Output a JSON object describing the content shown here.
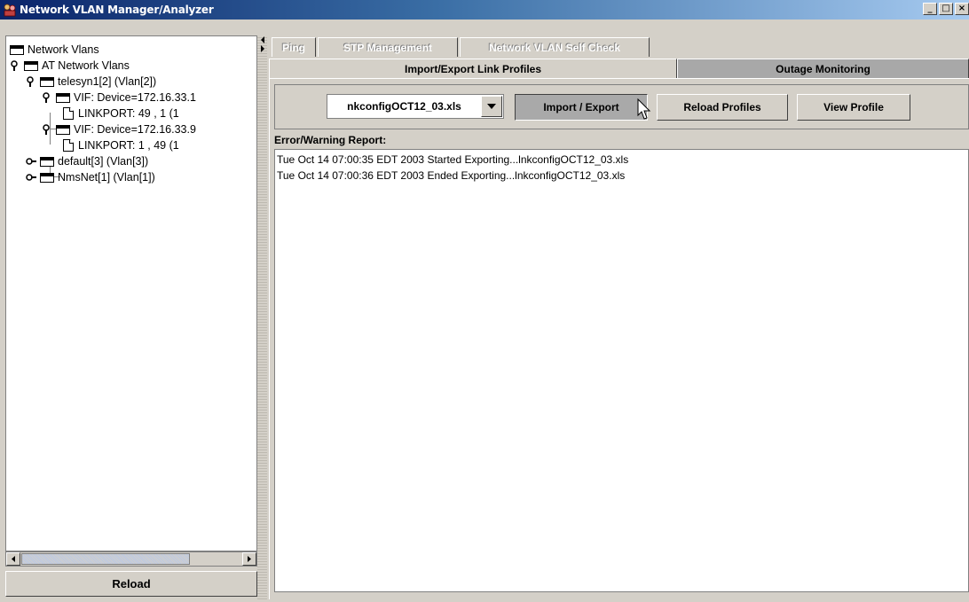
{
  "window": {
    "title": "Network VLAN Manager/Analyzer",
    "controls": {
      "minimize": "_",
      "maximize": "□",
      "close": "×"
    }
  },
  "tree": {
    "items": [
      {
        "label": "Network Vlans",
        "icon": "folder-icon"
      },
      {
        "label": "AT Network Vlans",
        "icon": "folder-icon"
      },
      {
        "label": "telesyn1[2] (Vlan[2])",
        "icon": "folder-icon"
      },
      {
        "label": "VIF: Device=172.16.33.1",
        "icon": "folder-icon"
      },
      {
        "label": "LINKPORT: 49  , 1 (1",
        "icon": "file-icon"
      },
      {
        "label": "VIF: Device=172.16.33.9",
        "icon": "folder-icon"
      },
      {
        "label": "LINKPORT: 1  , 49 (1",
        "icon": "file-icon"
      },
      {
        "label": "default[3] (Vlan[3])",
        "icon": "folder-icon"
      },
      {
        "label": "NmsNet[1] (Vlan[1])",
        "icon": "folder-icon"
      }
    ]
  },
  "reload_label": "Reload",
  "tabs": {
    "row1": [
      "Ping",
      "STP Management",
      "Network VLAN Self Check"
    ],
    "row2": [
      "Import/Export Link Profiles",
      "Outage Monitoring"
    ]
  },
  "toolbar": {
    "file_value": "nkconfigOCT12_03.xls",
    "import_export_label": "Import / Export",
    "reload_profiles_label": "Reload Profiles",
    "view_profile_label": "View Profile"
  },
  "report": {
    "label": "Error/Warning Report:",
    "lines": [
      "Tue Oct 14 07:00:35 EDT 2003 Started Exporting...lnkconfigOCT12_03.xls",
      "Tue Oct 14 07:00:36 EDT 2003 Ended Exporting...lnkconfigOCT12_03.xls"
    ]
  }
}
